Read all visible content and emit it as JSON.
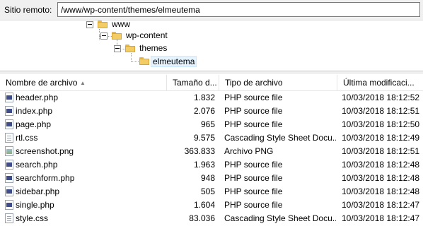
{
  "remote": {
    "label": "Sitio remoto:",
    "path": "/www/wp-content/themes/elmeutema"
  },
  "tree": {
    "nodes": [
      {
        "label": "www"
      },
      {
        "label": "wp-content"
      },
      {
        "label": "themes"
      },
      {
        "label": "elmeutema",
        "selected": true
      }
    ]
  },
  "list": {
    "columns": [
      "Nombre de archivo",
      "Tamaño d...",
      "Tipo de archivo",
      "Última modificaci..."
    ],
    "rows": [
      {
        "name": "header.php",
        "size": "1.832",
        "type": "PHP source file",
        "date": "10/03/2018 18:12:52",
        "icon": "php-file-icon"
      },
      {
        "name": "index.php",
        "size": "2.076",
        "type": "PHP source file",
        "date": "10/03/2018 18:12:51",
        "icon": "php-file-icon"
      },
      {
        "name": "page.php",
        "size": "965",
        "type": "PHP source file",
        "date": "10/03/2018 18:12:50",
        "icon": "php-file-icon"
      },
      {
        "name": "rtl.css",
        "size": "9.575",
        "type": "Cascading Style Sheet Docu...",
        "date": "10/03/2018 18:12:49",
        "icon": "css-file-icon"
      },
      {
        "name": "screenshot.png",
        "size": "363.833",
        "type": "Archivo PNG",
        "date": "10/03/2018 18:12:51",
        "icon": "png-file-icon"
      },
      {
        "name": "search.php",
        "size": "1.963",
        "type": "PHP source file",
        "date": "10/03/2018 18:12:48",
        "icon": "php-file-icon"
      },
      {
        "name": "searchform.php",
        "size": "948",
        "type": "PHP source file",
        "date": "10/03/2018 18:12:48",
        "icon": "php-file-icon"
      },
      {
        "name": "sidebar.php",
        "size": "505",
        "type": "PHP source file",
        "date": "10/03/2018 18:12:48",
        "icon": "php-file-icon"
      },
      {
        "name": "single.php",
        "size": "1.604",
        "type": "PHP source file",
        "date": "10/03/2018 18:12:47",
        "icon": "php-file-icon"
      },
      {
        "name": "style.css",
        "size": "83.036",
        "type": "Cascading Style Sheet Docu...",
        "date": "10/03/2018 18:12:47",
        "icon": "css-file-icon"
      }
    ]
  },
  "colors": {
    "folder": "#f3cd63",
    "selection": "#e5f3ff",
    "php_icon": "#3f4c8a"
  }
}
